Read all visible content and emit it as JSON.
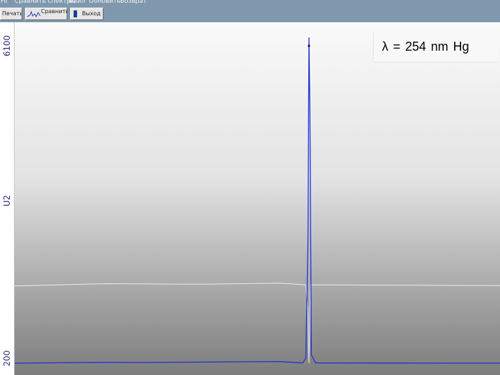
{
  "menu": {
    "items": [
      "Fil",
      "Сравнить спектры",
      "Файл",
      "Обновить",
      "Возврат"
    ]
  },
  "toolbar": {
    "print_label": "Печать",
    "compare_label": "Сравнить",
    "exit_label": "Выход"
  },
  "plot": {
    "y_max_label": "6100",
    "y_series_label": "U2",
    "y_min_label": "200",
    "annotation": "λ = 254 nm  Hg"
  },
  "colors": {
    "spectrum_line": "#1d2fd6",
    "baseline_line": "#e8ecf0",
    "menu_bar": "#7f98ad"
  },
  "chart_data": {
    "type": "line",
    "xlabel": "",
    "ylabel": "U2",
    "ylim": [
      200,
      6100
    ],
    "grid": false,
    "series": [
      {
        "values": [
          [
            0,
            200
          ],
          [
            0.19,
            215
          ],
          [
            0.26,
            212
          ],
          [
            0.39,
            220
          ],
          [
            0.545,
            230
          ],
          [
            0.5838,
            210
          ],
          [
            0.5938,
            205
          ],
          [
            0.6,
            290
          ],
          [
            0.6045,
            2400
          ],
          [
            0.6065,
            6100
          ],
          [
            0.6085,
            4700
          ],
          [
            0.6115,
            350
          ],
          [
            0.62,
            205
          ],
          [
            1,
            200
          ]
        ]
      },
      {
        "values": [
          [
            0,
            1600
          ],
          [
            0.19,
            1640
          ],
          [
            0.39,
            1630
          ],
          [
            0.545,
            1650
          ],
          [
            0.6,
            1620
          ],
          [
            0.6045,
            1100
          ],
          [
            0.6065,
            200
          ],
          [
            0.6095,
            1620
          ],
          [
            1,
            1605
          ]
        ]
      }
    ]
  }
}
